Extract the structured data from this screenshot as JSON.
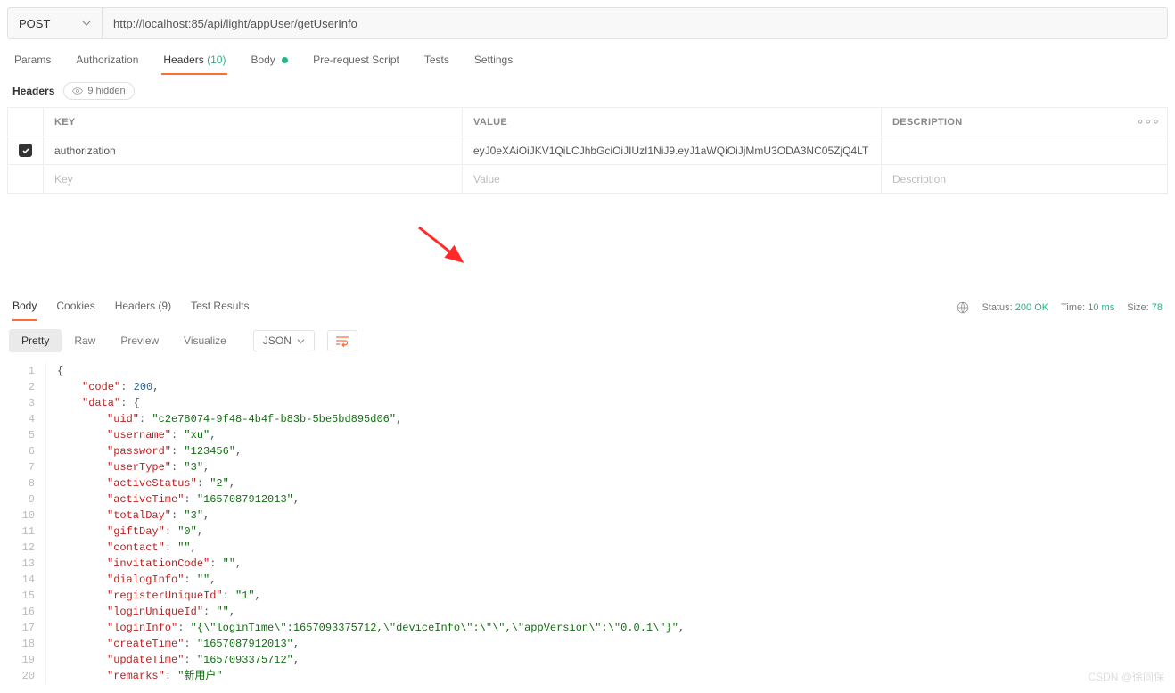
{
  "request": {
    "method": "POST",
    "url": "http://localhost:85/api/light/appUser/getUserInfo"
  },
  "reqTabs": {
    "params": "Params",
    "authorization": "Authorization",
    "headers": "Headers",
    "headersCount": "(10)",
    "body": "Body",
    "prescript": "Pre-request Script",
    "tests": "Tests",
    "settings": "Settings"
  },
  "headersSection": {
    "title": "Headers",
    "hidden": "9 hidden",
    "cols": {
      "key": "KEY",
      "value": "VALUE",
      "desc": "DESCRIPTION"
    },
    "row": {
      "key": "authorization",
      "value": "eyJ0eXAiOiJKV1QiLCJhbGciOiJIUzI1NiJ9.eyJ1aWQiOiJjMmU3ODA3NC05ZjQ4LT"
    },
    "placeholders": {
      "key": "Key",
      "value": "Value",
      "desc": "Description"
    }
  },
  "respTabs": {
    "body": "Body",
    "cookies": "Cookies",
    "headers": "Headers",
    "headersCount": "(9)",
    "testResults": "Test Results"
  },
  "status": {
    "statusLabel": "Status:",
    "statusValue": "200 OK",
    "timeLabel": "Time:",
    "timeValue": "10 ms",
    "sizeLabel": "Size:",
    "sizeValue": "78"
  },
  "viewBar": {
    "pretty": "Pretty",
    "raw": "Raw",
    "preview": "Preview",
    "visualize": "Visualize",
    "format": "JSON"
  },
  "responseBody": {
    "code": 200,
    "data": {
      "uid": "c2e78074-9f48-4b4f-b83b-5be5bd895d06",
      "username": "xu",
      "password": "123456",
      "userType": "3",
      "activeStatus": "2",
      "activeTime": "1657087912013",
      "totalDay": "3",
      "giftDay": "0",
      "contact": "",
      "invitationCode": "",
      "dialogInfo": "",
      "registerUniqueId": "1",
      "loginUniqueId": "",
      "loginInfo": "{\\\"loginTime\\\":1657093375712,\\\"deviceInfo\\\":\\\"\\\",\\\"appVersion\\\":\\\"0.0.1\\\"}",
      "createTime": "1657087912013",
      "updateTime": "1657093375712",
      "remarks": "新用户"
    }
  },
  "watermark": "CSDN @徐同保"
}
